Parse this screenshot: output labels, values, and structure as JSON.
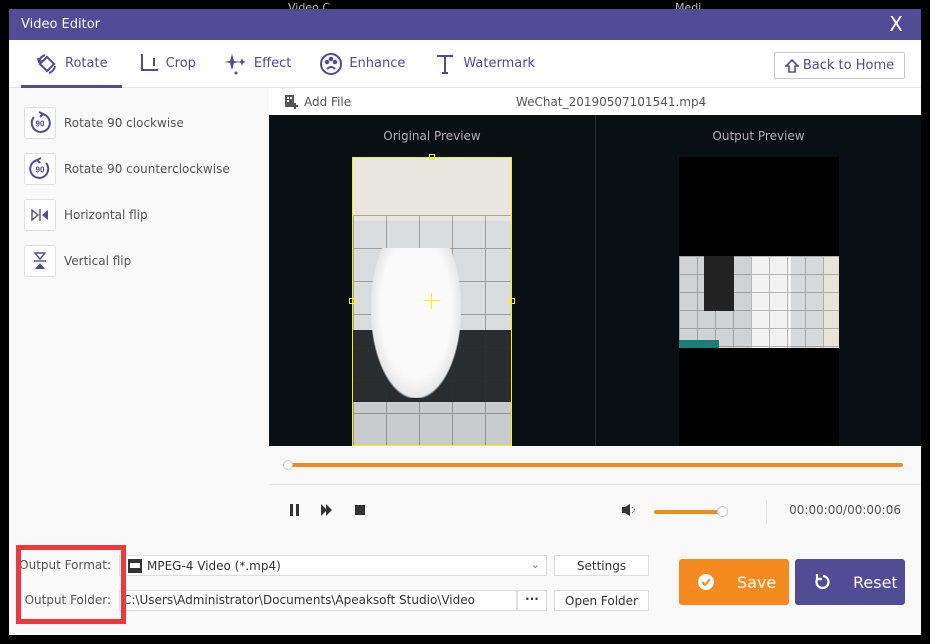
{
  "background": {
    "partial_labels": [
      "Video C...",
      "Medi..."
    ]
  },
  "window": {
    "title": "Video Editor",
    "close_label": "X"
  },
  "tabs": [
    {
      "label": "Rotate",
      "icon": "rotate-icon",
      "active": true
    },
    {
      "label": "Crop",
      "icon": "crop-icon",
      "active": false
    },
    {
      "label": "Effect",
      "icon": "sparkle-icon",
      "active": false
    },
    {
      "label": "Enhance",
      "icon": "palette-icon",
      "active": false
    },
    {
      "label": "Watermark",
      "icon": "text-t-icon",
      "active": false
    }
  ],
  "back_home": {
    "label": "Back to Home",
    "icon": "home-icon"
  },
  "sidebar": {
    "items": [
      {
        "label": "Rotate 90 clockwise",
        "icon": "rotate-cw-90-icon",
        "badge": "90"
      },
      {
        "label": "Rotate 90 counterclockwise",
        "icon": "rotate-ccw-90-icon",
        "badge": "90"
      },
      {
        "label": "Horizontal flip",
        "icon": "horizontal-flip-icon"
      },
      {
        "label": "Vertical flip",
        "icon": "vertical-flip-icon"
      }
    ]
  },
  "filebar": {
    "add_file_label": "Add File",
    "filename": "WeChat_20190507101541.mp4"
  },
  "preview": {
    "original_label": "Original Preview",
    "output_label": "Output Preview"
  },
  "playback": {
    "progress": 0,
    "volume": 0.93,
    "time": "00:00:00/00:00:06"
  },
  "output": {
    "format_label": "Output Format:",
    "format_value": "MPEG-4 Video (*.mp4)",
    "folder_label": "Output Folder:",
    "folder_value": "C:\\Users\\Administrator\\Documents\\Apeaksoft Studio\\Video",
    "browse_label": "···",
    "settings_label": "Settings",
    "open_folder_label": "Open Folder"
  },
  "actions": {
    "save_label": "Save",
    "reset_label": "Reset"
  },
  "colors": {
    "brand": "#524b96",
    "accent": "#f58a1f",
    "highlight": "#f0383c",
    "crop_frame": "#f5f500"
  }
}
